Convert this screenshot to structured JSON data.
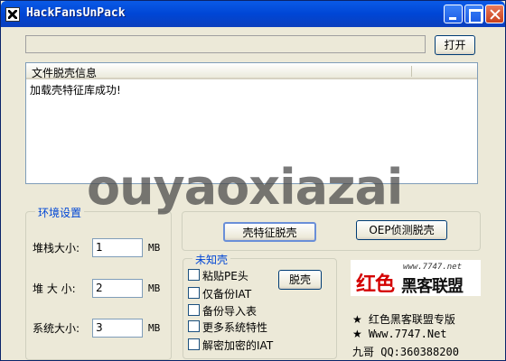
{
  "window": {
    "title": "HackFansUnPack"
  },
  "top": {
    "path_value": "",
    "open_label": "打开"
  },
  "listview": {
    "column": "文件脱壳信息",
    "rows": [
      "加载壳特征库成功!"
    ]
  },
  "env": {
    "legend": "环境设置",
    "fields": [
      {
        "label": "堆栈大小:",
        "value": "1",
        "unit": "MB"
      },
      {
        "label": "堆 大 小:",
        "value": "2",
        "unit": "MB"
      },
      {
        "label": "系统大小:",
        "value": "3",
        "unit": "MB"
      }
    ]
  },
  "actions": {
    "sig_unpack_label": "壳特征脱壳",
    "oep_label": "OEP侦测脱壳"
  },
  "unknown": {
    "legend": "未知壳",
    "unpack_label": "脱壳",
    "options": [
      "粘贴PE头",
      "仅备份IAT",
      "备份导入表",
      "更多系统特性",
      "解密加密的IAT"
    ]
  },
  "branding": {
    "logo_red": "红色",
    "logo_black": "黑客联盟",
    "logo_url": "www.7747.net",
    "line1_star": "★",
    "line1": "红色黑客联盟专版",
    "line2_star": "★",
    "line2": "Www.7747.Net",
    "line3": "九哥  QQ:360388200"
  },
  "watermark": "ouyaoxiazai"
}
